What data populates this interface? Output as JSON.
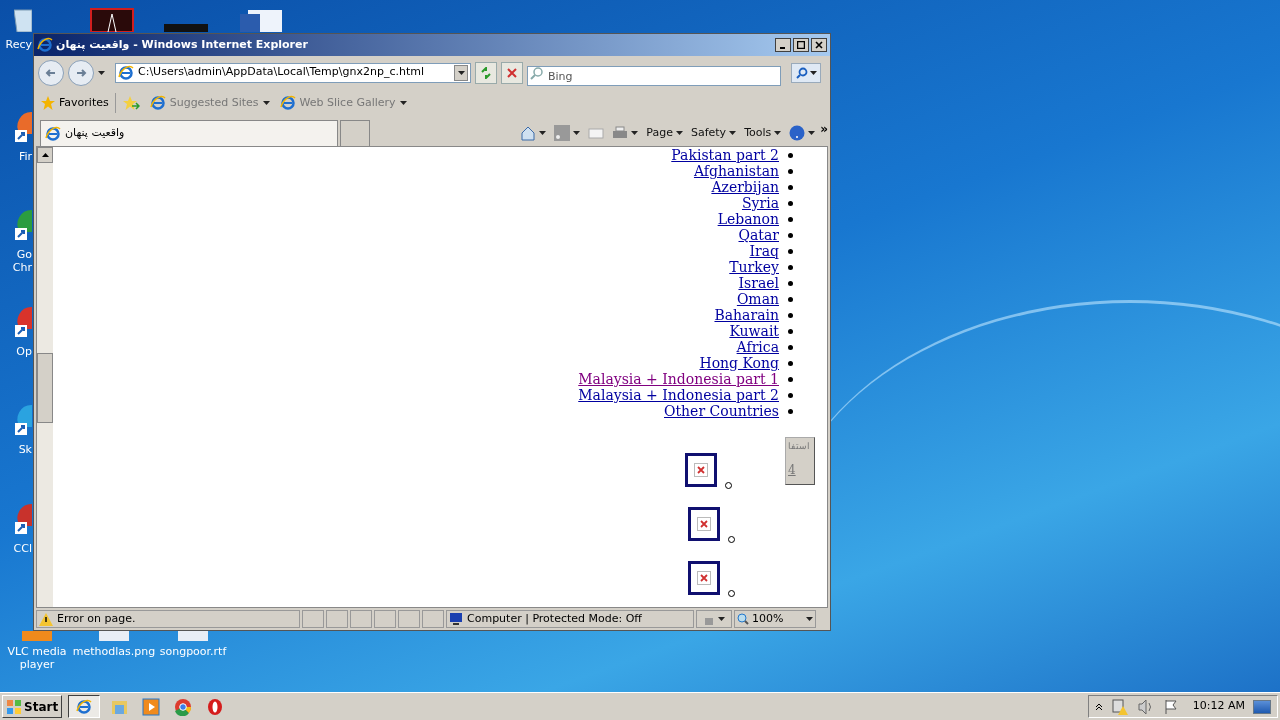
{
  "desktop_icons": [
    {
      "label": "Recy",
      "kind": "bin"
    },
    {
      "label": "Fir",
      "kind": "shortcut"
    },
    {
      "label": "Go Chr",
      "kind": "shortcut"
    },
    {
      "label": "Op",
      "kind": "shortcut"
    },
    {
      "label": "Sk",
      "kind": "shortcut"
    },
    {
      "label": "CCl",
      "kind": "shortcut"
    }
  ],
  "bottom_icons": [
    {
      "label": "VLC media player"
    },
    {
      "label": "methodlas.png"
    },
    {
      "label": "songpoor.rtf"
    }
  ],
  "window": {
    "title": "واقعیت پنهان - Windows Internet Explorer",
    "address": "C:\\Users\\admin\\AppData\\Local\\Temp\\gnx2np_c.html",
    "search_placeholder": "Bing",
    "favorites": "Favorites",
    "favorites_links": [
      "Suggested Sites",
      "Web Slice Gallery"
    ],
    "tab": {
      "label": "واقعیت پنهان",
      "selected": true
    },
    "commands": [
      "Page",
      "Safety",
      "Tools"
    ],
    "chevron": "»"
  },
  "page": {
    "links": [
      {
        "text": "Pakistan part 2",
        "visited": false
      },
      {
        "text": "Afghanistan",
        "visited": false
      },
      {
        "text": "Azerbijan",
        "visited": false
      },
      {
        "text": "Syria",
        "visited": false
      },
      {
        "text": "Lebanon",
        "visited": false
      },
      {
        "text": "Qatar",
        "visited": false
      },
      {
        "text": "Iraq",
        "visited": false
      },
      {
        "text": "Turkey",
        "visited": false
      },
      {
        "text": "Israel",
        "visited": false
      },
      {
        "text": "Oman",
        "visited": false
      },
      {
        "text": "Baharain",
        "visited": false
      },
      {
        "text": "Kuwait",
        "visited": false
      },
      {
        "text": "Africa",
        "visited": false
      },
      {
        "text": "Hong Kong",
        "visited": false
      },
      {
        "text": "Malaysia + Indonesia part 1",
        "visited": true
      },
      {
        "text": "Malaysia + Indonesia part 2",
        "visited": false
      },
      {
        "text": "Other Countries",
        "visited": false
      }
    ],
    "button": {
      "line_1": "استفا",
      "line_2": "4"
    },
    "images": [
      {
        "kind": "broken"
      },
      {
        "kind": "broken"
      },
      {
        "kind": "broken"
      }
    ]
  },
  "status_bar": {
    "message": "Error on page.",
    "zone": "Computer | Protected Mode: Off",
    "zoom": "100%"
  },
  "taskbar": {
    "start": "Start",
    "clock": "10:12 AM"
  }
}
